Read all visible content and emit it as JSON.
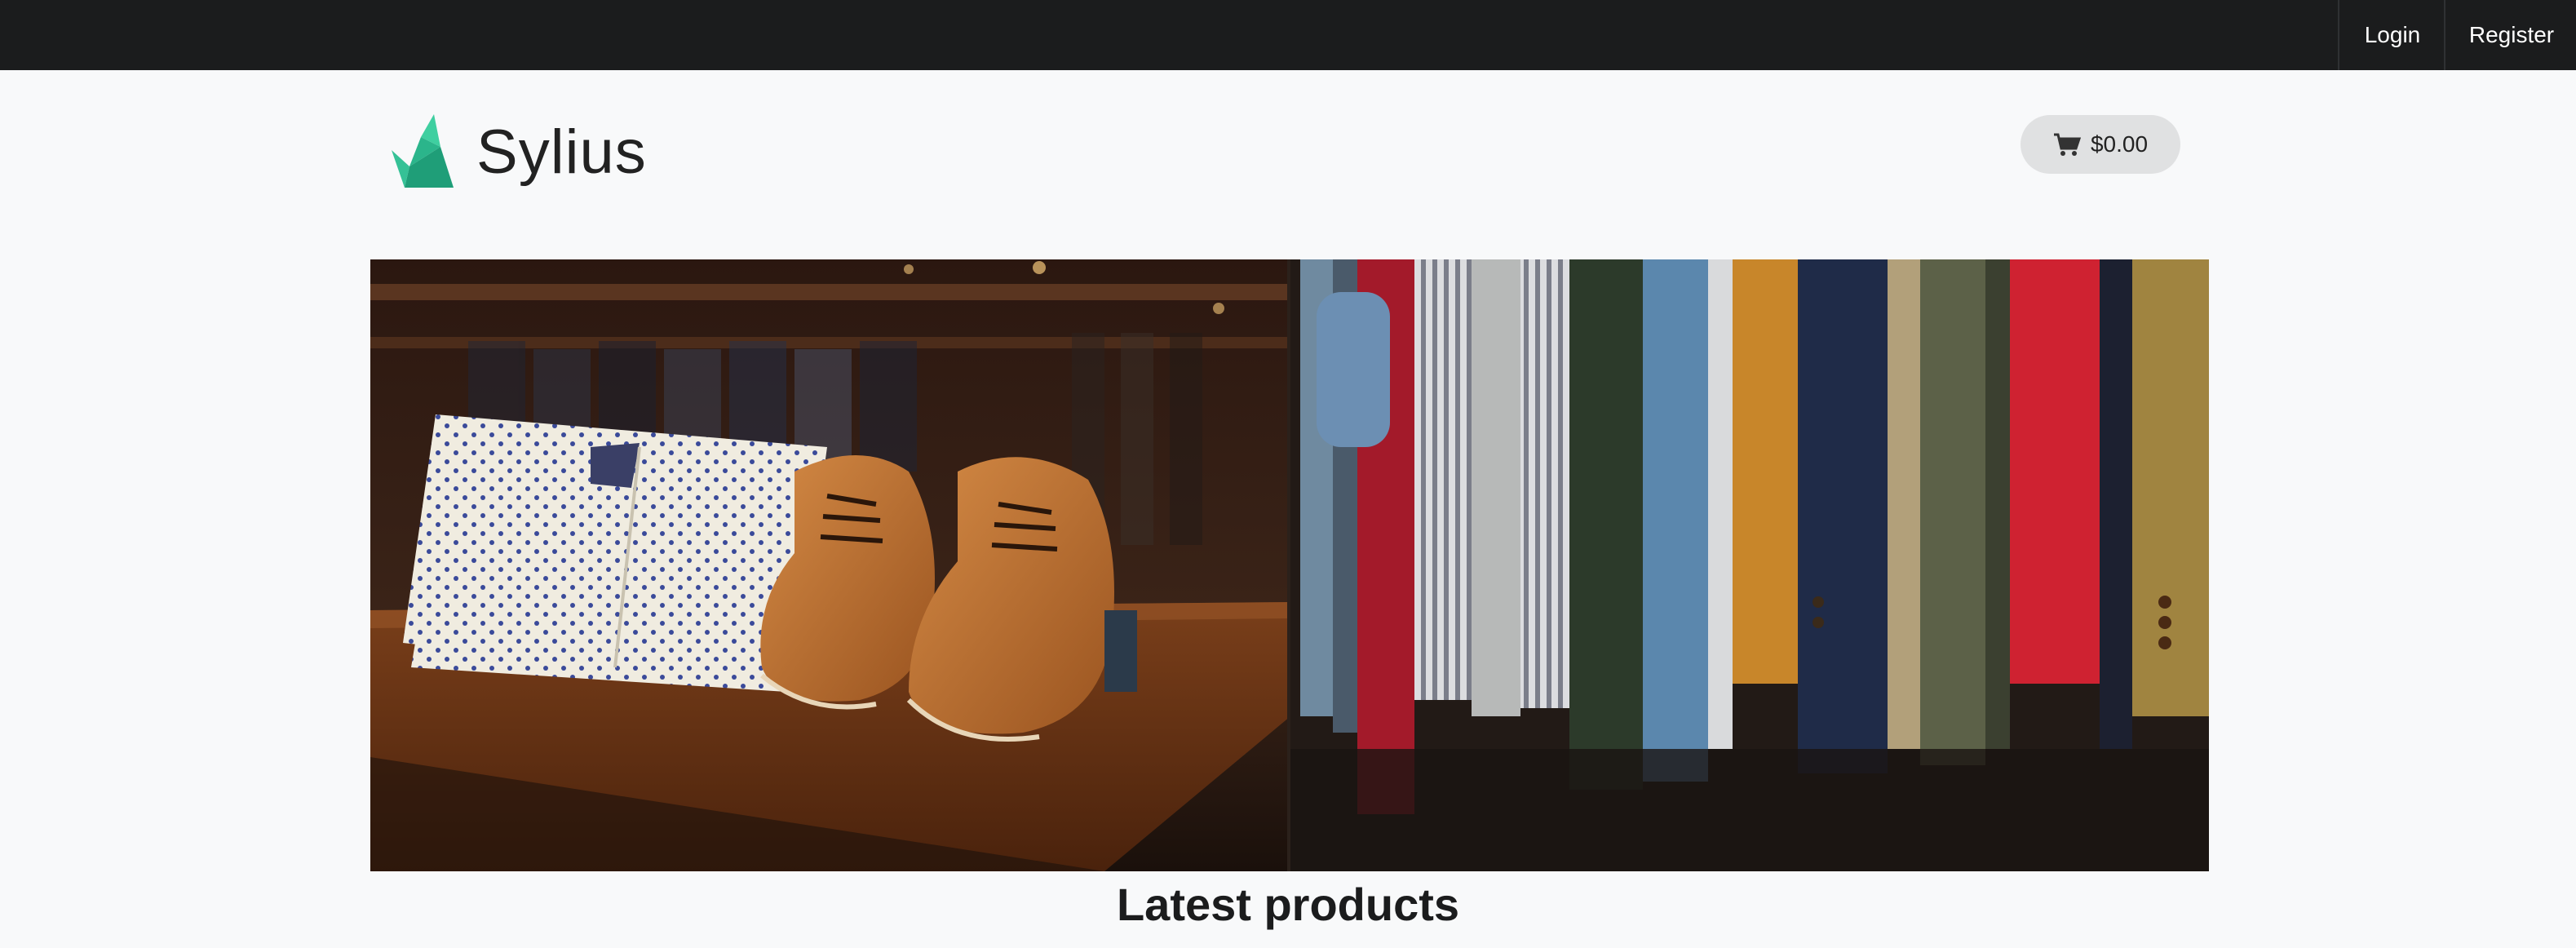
{
  "topbar": {
    "login_label": "Login",
    "register_label": "Register"
  },
  "header": {
    "logo_text": "Sylius",
    "logo_icon": "swan-logo-icon",
    "cart_total": "$0.00",
    "cart_icon": "cart-icon"
  },
  "banner": {
    "description": "hero-image"
  },
  "main": {
    "section_title": "Latest products"
  },
  "colors": {
    "topbar_bg": "#1b1c1d",
    "page_bg": "#f8f9fa",
    "brand_green": "#2bb58b",
    "cart_bg": "#e0e1e2"
  }
}
